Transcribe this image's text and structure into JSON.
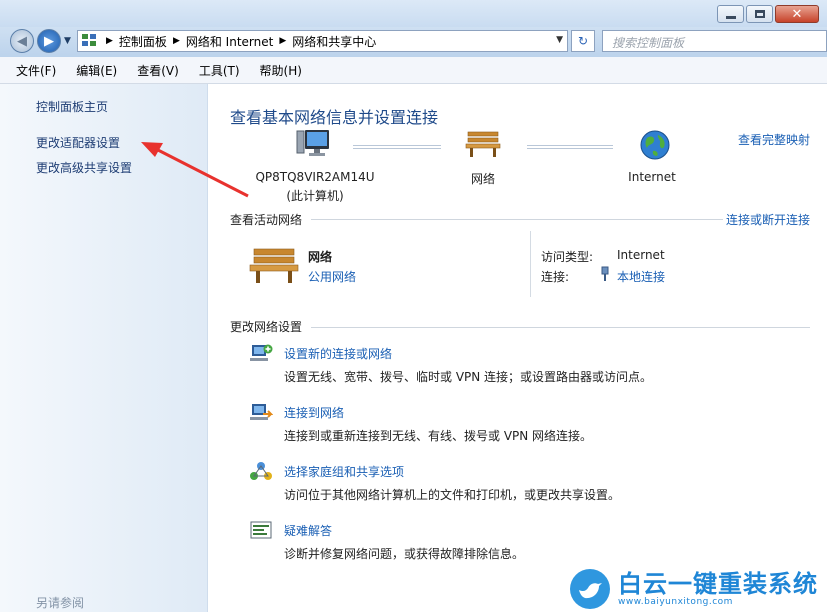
{
  "window": {
    "controls": {
      "minimize_icon": "minimize-icon",
      "maximize_icon": "maximize-icon",
      "close_icon": "close-icon"
    }
  },
  "nav": {
    "breadcrumb": [
      "控制面板",
      "网络和 Internet",
      "网络和共享中心"
    ],
    "search_placeholder": "搜索控制面板"
  },
  "menu": [
    "文件(F)",
    "编辑(E)",
    "查看(V)",
    "工具(T)",
    "帮助(H)"
  ],
  "sidebar": {
    "links": [
      "控制面板主页",
      "更改适配器设置",
      "更改高级共享设置"
    ],
    "see_also": "另请参阅"
  },
  "main": {
    "title": "查看基本网络信息并设置连接",
    "full_map_link": "查看完整映射",
    "network_map": {
      "computer_name": "QP8TQ8VIR2AM14U",
      "computer_sub": "(此计算机)",
      "network": "网络",
      "internet": "Internet"
    },
    "active_section": {
      "title": "查看活动网络",
      "connect_link": "连接或断开连接",
      "network_name": "网络",
      "network_type": "公用网络",
      "access_type_key": "访问类型:",
      "access_type_value": "Internet",
      "connection_key": "连接:",
      "connection_value": "本地连接"
    },
    "change_section": {
      "title": "更改网络设置",
      "tasks": [
        {
          "title": "设置新的连接或网络",
          "desc": "设置无线、宽带、拨号、临时或 VPN 连接；或设置路由器或访问点。"
        },
        {
          "title": "连接到网络",
          "desc": "连接到或重新连接到无线、有线、拨号或 VPN 网络连接。"
        },
        {
          "title": "选择家庭组和共享选项",
          "desc": "访问位于其他网络计算机上的文件和打印机，或更改共享设置。"
        },
        {
          "title": "疑难解答",
          "desc": "诊断并修复网络问题，或获得故障排除信息。"
        }
      ]
    }
  },
  "watermark": {
    "name": "白云一键重装系统",
    "url": "www.baiyunxitong.com"
  },
  "colors": {
    "link": "#1a5fb4",
    "title": "#1f4a8a",
    "arrow": "#e8322e",
    "watermark": "#1f86d6"
  }
}
